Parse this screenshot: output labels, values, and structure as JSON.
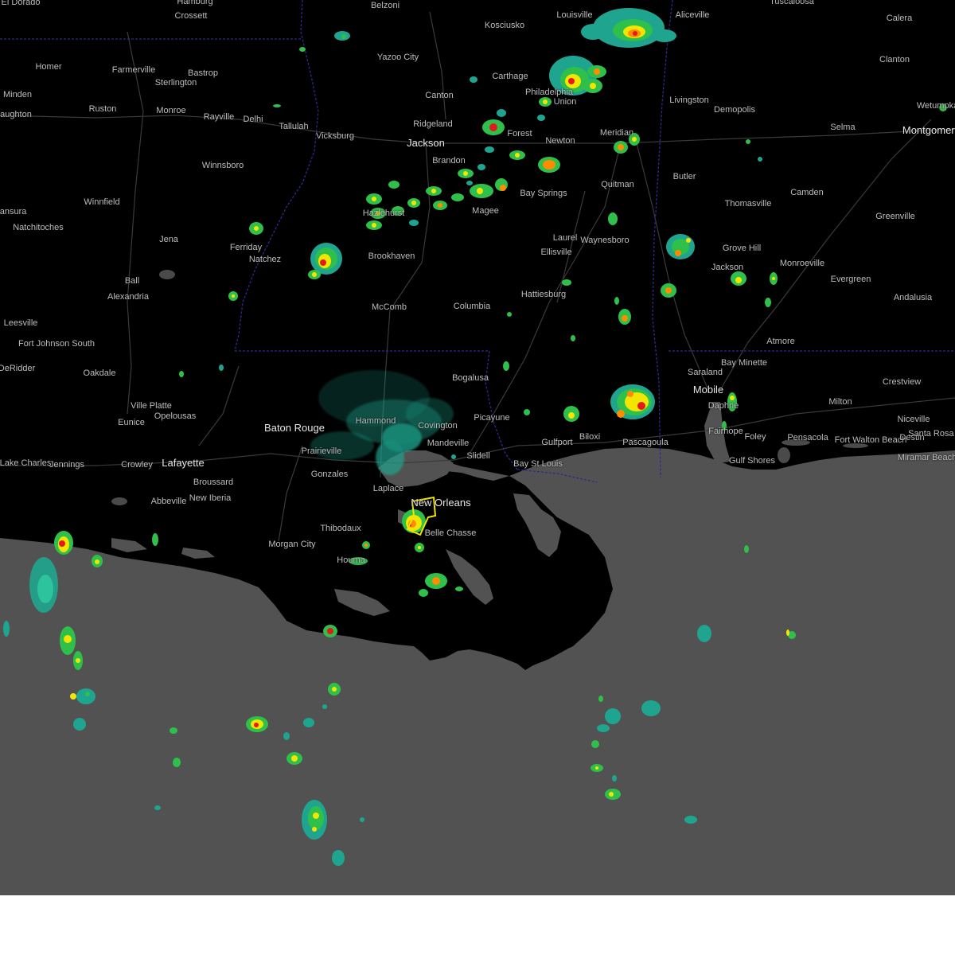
{
  "map": {
    "region": "Lower Mississippi Valley / Central Gulf Coast radar view",
    "colors": {
      "land": "#000000",
      "water": "#525252",
      "roads": "#3a3a3a",
      "state_border": "#2b2b8f",
      "warning_polygon": "#f2e600",
      "radar_light": "#1fa58f",
      "radar_moderate": "#2fbf4b",
      "radar_heavy": "#f2e600",
      "radar_intense": "#ff8c00",
      "radar_extreme": "#e31a1c"
    },
    "cities": [
      {
        "name": "El Dorado",
        "major": false
      },
      {
        "name": "Hamburg",
        "major": false
      },
      {
        "name": "Crossett",
        "major": false
      },
      {
        "name": "Belzoni",
        "major": false
      },
      {
        "name": "Kosciusko",
        "major": false
      },
      {
        "name": "Louisville",
        "major": false
      },
      {
        "name": "Aliceville",
        "major": false
      },
      {
        "name": "Tuscaloosa",
        "major": false
      },
      {
        "name": "Calera",
        "major": false
      },
      {
        "name": "Yazoo City",
        "major": false
      },
      {
        "name": "Homer",
        "major": false
      },
      {
        "name": "Farmerville",
        "major": false
      },
      {
        "name": "Bastrop",
        "major": false
      },
      {
        "name": "Sterlington",
        "major": false
      },
      {
        "name": "Carthage",
        "major": false
      },
      {
        "name": "Philadelphia",
        "major": false
      },
      {
        "name": "Clanton",
        "major": false
      },
      {
        "name": "Minden",
        "major": false
      },
      {
        "name": "Canton",
        "major": false
      },
      {
        "name": "Union",
        "major": false
      },
      {
        "name": "Livingston",
        "major": false
      },
      {
        "name": "Wetumpka",
        "major": false
      },
      {
        "name": "Ruston",
        "major": false
      },
      {
        "name": "Monroe",
        "major": false
      },
      {
        "name": "Rayville",
        "major": false
      },
      {
        "name": "Delhi",
        "major": false
      },
      {
        "name": "Demopolis",
        "major": false
      },
      {
        "name": "Haughton",
        "major": false
      },
      {
        "name": "Tallulah",
        "major": false
      },
      {
        "name": "Ridgeland",
        "major": false
      },
      {
        "name": "Forest",
        "major": false
      },
      {
        "name": "Meridian",
        "major": false
      },
      {
        "name": "Selma",
        "major": false
      },
      {
        "name": "Montgomery",
        "major": true
      },
      {
        "name": "Vicksburg",
        "major": false
      },
      {
        "name": "Jackson",
        "major": true
      },
      {
        "name": "Newton",
        "major": false
      },
      {
        "name": "Brandon",
        "major": false
      },
      {
        "name": "Winnsboro",
        "major": false
      },
      {
        "name": "Butler",
        "major": false
      },
      {
        "name": "Bay Springs",
        "major": false
      },
      {
        "name": "Quitman",
        "major": false
      },
      {
        "name": "Camden",
        "major": false
      },
      {
        "name": "Natchitoches",
        "major": false
      },
      {
        "name": "Winnfield",
        "major": false
      },
      {
        "name": "Hazlehurst",
        "major": false
      },
      {
        "name": "Magee",
        "major": false
      },
      {
        "name": "Thomasville",
        "major": false
      },
      {
        "name": "Greenville",
        "major": false
      },
      {
        "name": "Mansura",
        "major": false
      },
      {
        "name": "Jena",
        "major": false
      },
      {
        "name": "Laurel",
        "major": false
      },
      {
        "name": "Waynesboro",
        "major": false
      },
      {
        "name": "Ferriday",
        "major": false
      },
      {
        "name": "Brookhaven",
        "major": false
      },
      {
        "name": "Ellisville",
        "major": false
      },
      {
        "name": "Grove Hill",
        "major": false
      },
      {
        "name": "Natchez",
        "major": false
      },
      {
        "name": "Monroeville",
        "major": false
      },
      {
        "name": "Jackson",
        "major": false
      },
      {
        "name": "Ball",
        "major": false
      },
      {
        "name": "Evergreen",
        "major": false
      },
      {
        "name": "Alexandria",
        "major": false
      },
      {
        "name": "Hattiesburg",
        "major": false
      },
      {
        "name": "Andalusia",
        "major": false
      },
      {
        "name": "McComb",
        "major": false
      },
      {
        "name": "Columbia",
        "major": false
      },
      {
        "name": "Leesville",
        "major": false
      },
      {
        "name": "Fort Johnson South",
        "major": false
      },
      {
        "name": "Atmore",
        "major": false
      },
      {
        "name": "Bay Minette",
        "major": false
      },
      {
        "name": "DeRidder",
        "major": false
      },
      {
        "name": "Oakdale",
        "major": false
      },
      {
        "name": "Bogalusa",
        "major": false
      },
      {
        "name": "Saraland",
        "major": false
      },
      {
        "name": "Crestview",
        "major": false
      },
      {
        "name": "Mobile",
        "major": true
      },
      {
        "name": "Ville Platte",
        "major": false
      },
      {
        "name": "Milton",
        "major": false
      },
      {
        "name": "Daphne",
        "major": false
      },
      {
        "name": "Opelousas",
        "major": false
      },
      {
        "name": "Eunice",
        "major": false
      },
      {
        "name": "Niceville",
        "major": false
      },
      {
        "name": "Picayune",
        "major": false
      },
      {
        "name": "Hammond",
        "major": false
      },
      {
        "name": "Covington",
        "major": false
      },
      {
        "name": "Baton Rouge",
        "major": true
      },
      {
        "name": "Biloxi",
        "major": false
      },
      {
        "name": "Gulfport",
        "major": false
      },
      {
        "name": "Fairhope",
        "major": false
      },
      {
        "name": "Foley",
        "major": false
      },
      {
        "name": "Pensacola",
        "major": false
      },
      {
        "name": "Fort Walton Beach",
        "major": false
      },
      {
        "name": "Destin",
        "major": false
      },
      {
        "name": "Santa Rosa Beach",
        "major": false
      },
      {
        "name": "Mandeville",
        "major": false
      },
      {
        "name": "Pascagoula",
        "major": false
      },
      {
        "name": "Prairieville",
        "major": false
      },
      {
        "name": "Slidell",
        "major": false
      },
      {
        "name": "Lake Charles",
        "major": false
      },
      {
        "name": "Jennings",
        "major": false
      },
      {
        "name": "Crowley",
        "major": false
      },
      {
        "name": "Lafayette",
        "major": true
      },
      {
        "name": "Bay St Louis",
        "major": false
      },
      {
        "name": "Gulf Shores",
        "major": false
      },
      {
        "name": "Miramar Beach",
        "major": false
      },
      {
        "name": "Gonzales",
        "major": false
      },
      {
        "name": "Broussard",
        "major": false
      },
      {
        "name": "Laplace",
        "major": false
      },
      {
        "name": "New Orleans",
        "major": true
      },
      {
        "name": "Abbeville",
        "major": false
      },
      {
        "name": "New Iberia",
        "major": false
      },
      {
        "name": "Thibodaux",
        "major": false
      },
      {
        "name": "Belle Chasse",
        "major": false
      },
      {
        "name": "Morgan City",
        "major": false
      },
      {
        "name": "Houma",
        "major": false
      }
    ]
  }
}
